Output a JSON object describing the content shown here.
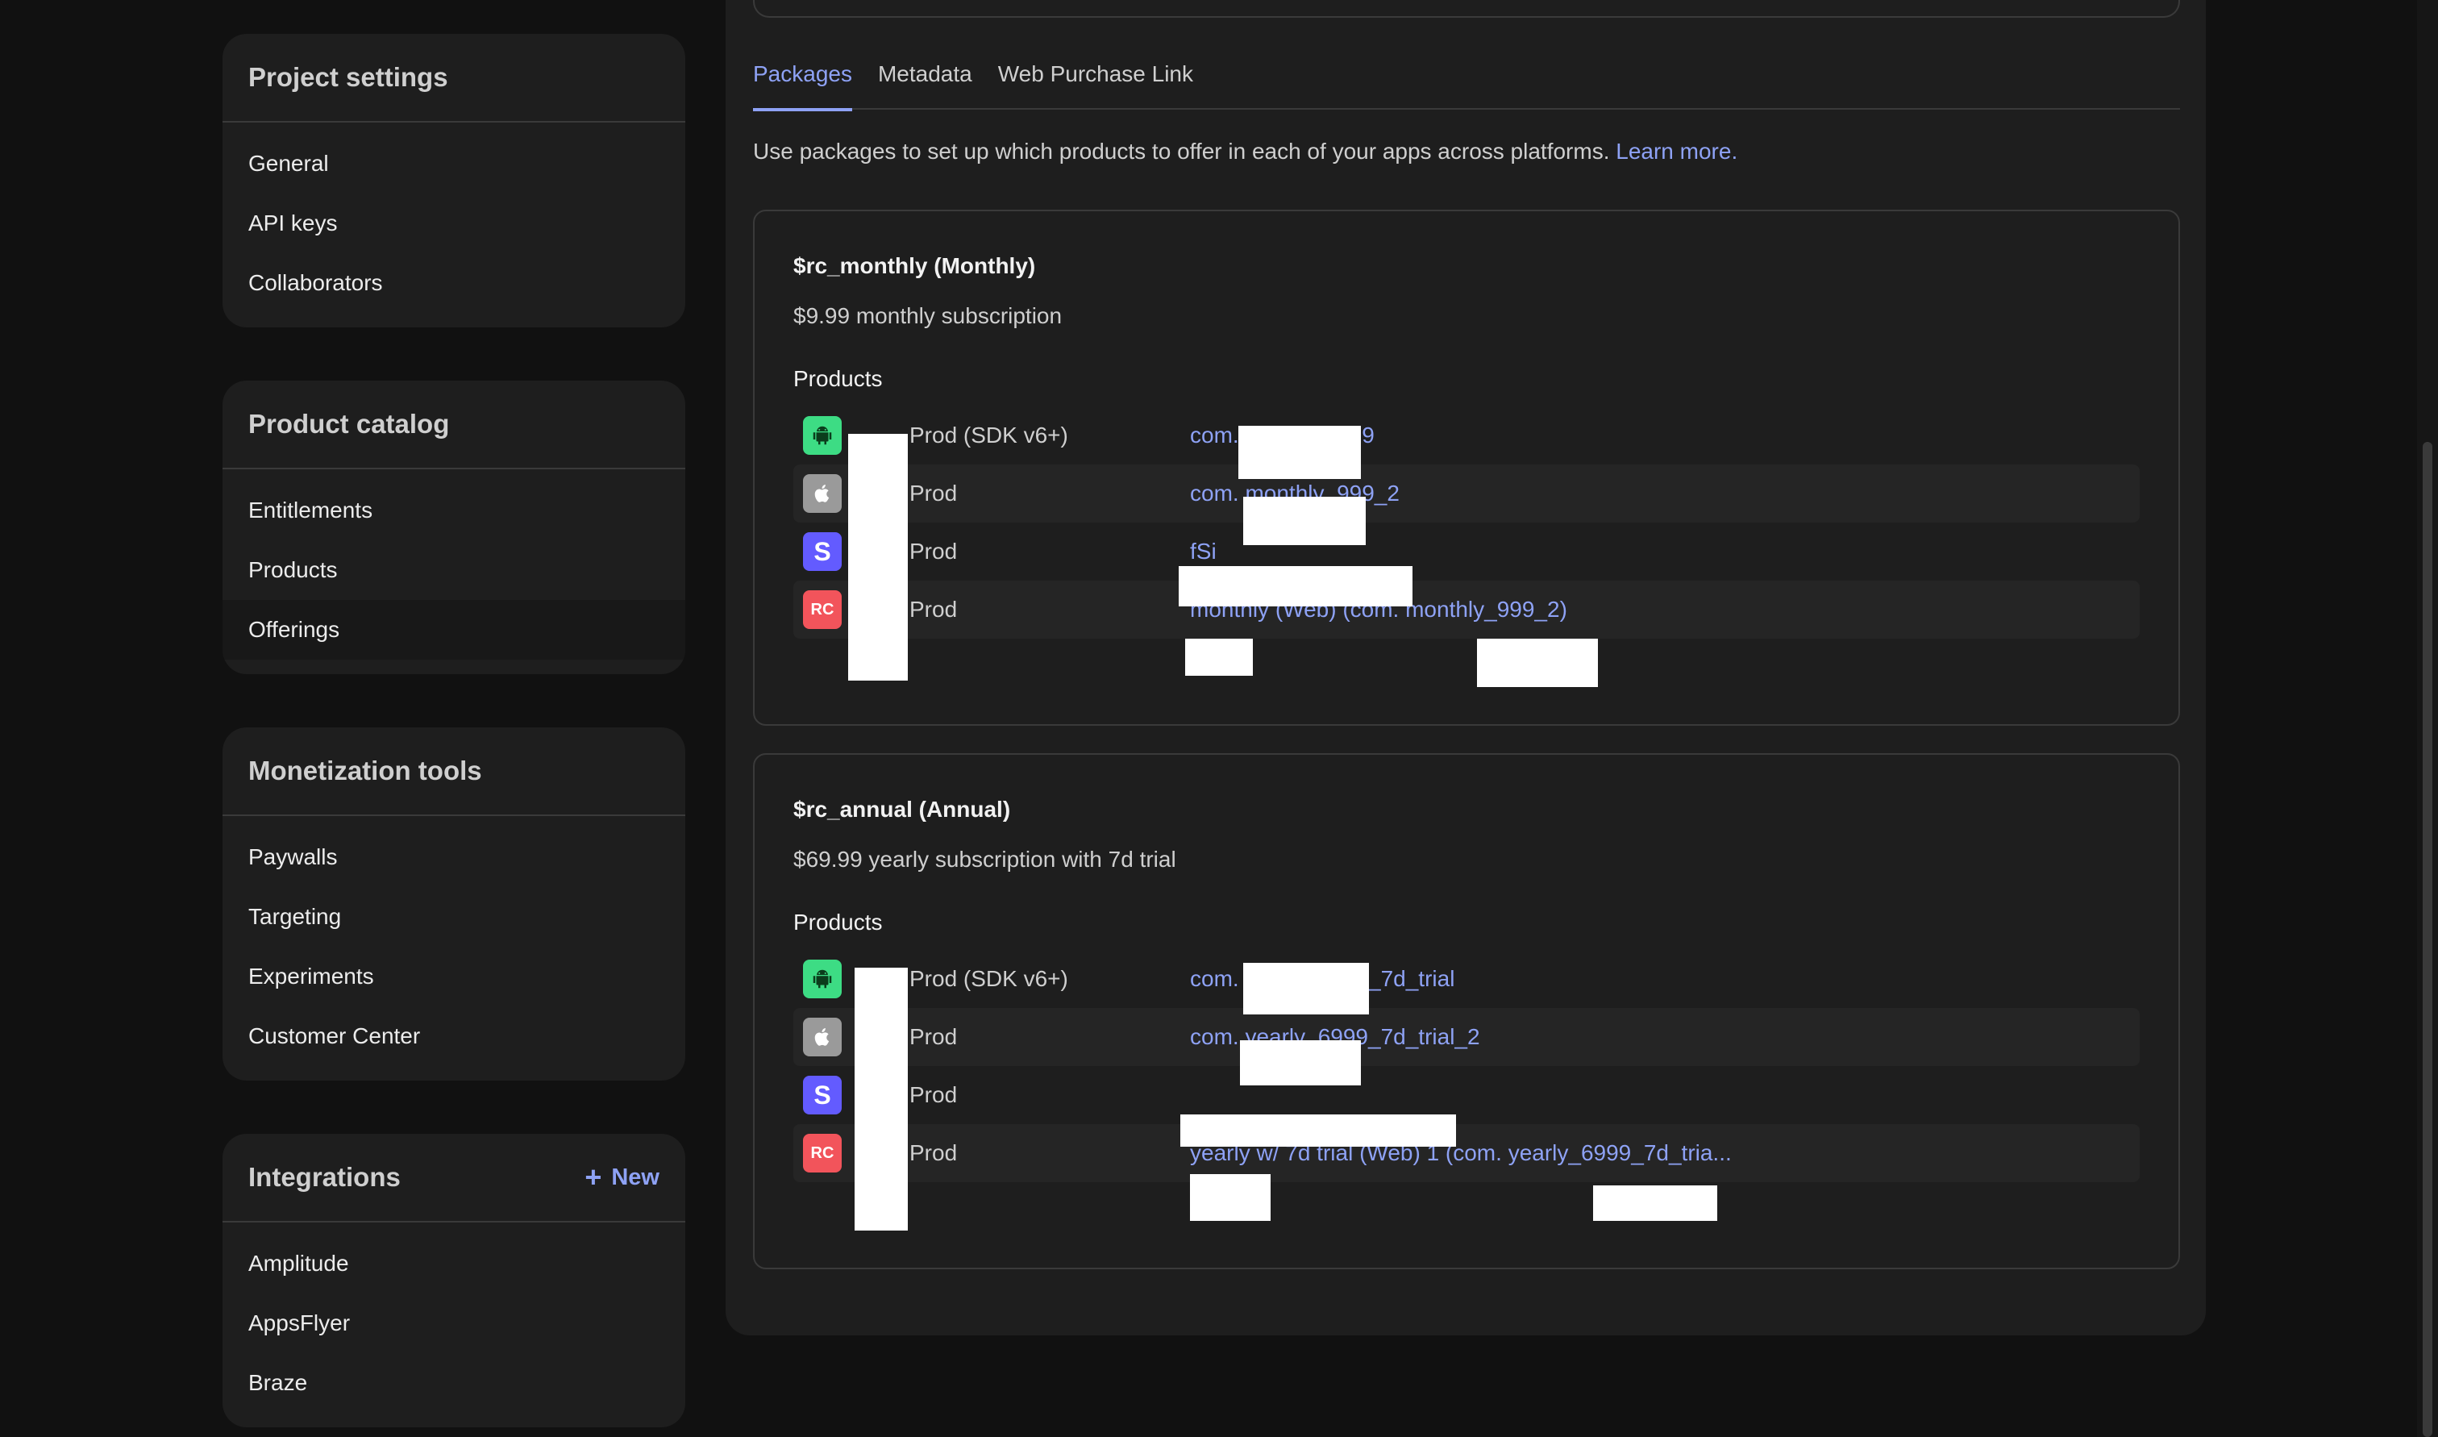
{
  "sidebar": {
    "project_settings": {
      "title": "Project settings",
      "items": [
        "General",
        "API keys",
        "Collaborators"
      ]
    },
    "product_catalog": {
      "title": "Product catalog",
      "items": [
        "Entitlements",
        "Products",
        "Offerings"
      ]
    },
    "monetization_tools": {
      "title": "Monetization tools",
      "items": [
        "Paywalls",
        "Targeting",
        "Experiments",
        "Customer Center"
      ]
    },
    "integrations": {
      "title": "Integrations",
      "new_label": "New",
      "items": [
        "Amplitude",
        "AppsFlyer",
        "Braze"
      ]
    }
  },
  "tabs": [
    "Packages",
    "Metadata",
    "Web Purchase Link"
  ],
  "description": {
    "text": "Use packages to set up which products to offer in each of your apps across platforms.",
    "link": "Learn more."
  },
  "packages": [
    {
      "name": "$rc_monthly (Monthly)",
      "description": "$9.99 monthly subscription",
      "products_label": "Products",
      "products": [
        {
          "icon": "android-icon",
          "name": "Prod (SDK v6+)",
          "id": "com.                        monthly_999"
        },
        {
          "icon": "apple-icon",
          "name": "Prod",
          "id": "com.                        monthly_999_2"
        },
        {
          "icon": "stripe-icon",
          "name": "Prod",
          "id": "                                                                 fSi"
        },
        {
          "icon": "revenuecat-icon",
          "name": "Prod",
          "id": "             monthly (Web) (com.                        monthly_999_2)"
        }
      ]
    },
    {
      "name": "$rc_annual (Annual)",
      "description": "$69.99 yearly subscription with 7d trial",
      "products_label": "Products",
      "products": [
        {
          "icon": "android-icon",
          "name": "Prod (SDK v6+)",
          "id": "com.                        yearly_6999_7d_trial"
        },
        {
          "icon": "apple-icon",
          "name": "Prod",
          "id": "com.                        yearly_6999_7d_trial_2"
        },
        {
          "icon": "stripe-icon",
          "name": "Prod",
          "id": ""
        },
        {
          "icon": "revenuecat-icon",
          "name": "Prod",
          "id": "               yearly w/ 7d trial (Web) 1 (com.                        yearly_6999_7d_tria..."
        }
      ]
    }
  ],
  "icons": {
    "android": "🤖",
    "apple": "",
    "stripe": "S",
    "rc": "RC"
  },
  "colors": {
    "accent": "#8ea2f5",
    "android": "#3ddc84",
    "stripe": "#635bff",
    "revenuecat": "#f2545b"
  }
}
